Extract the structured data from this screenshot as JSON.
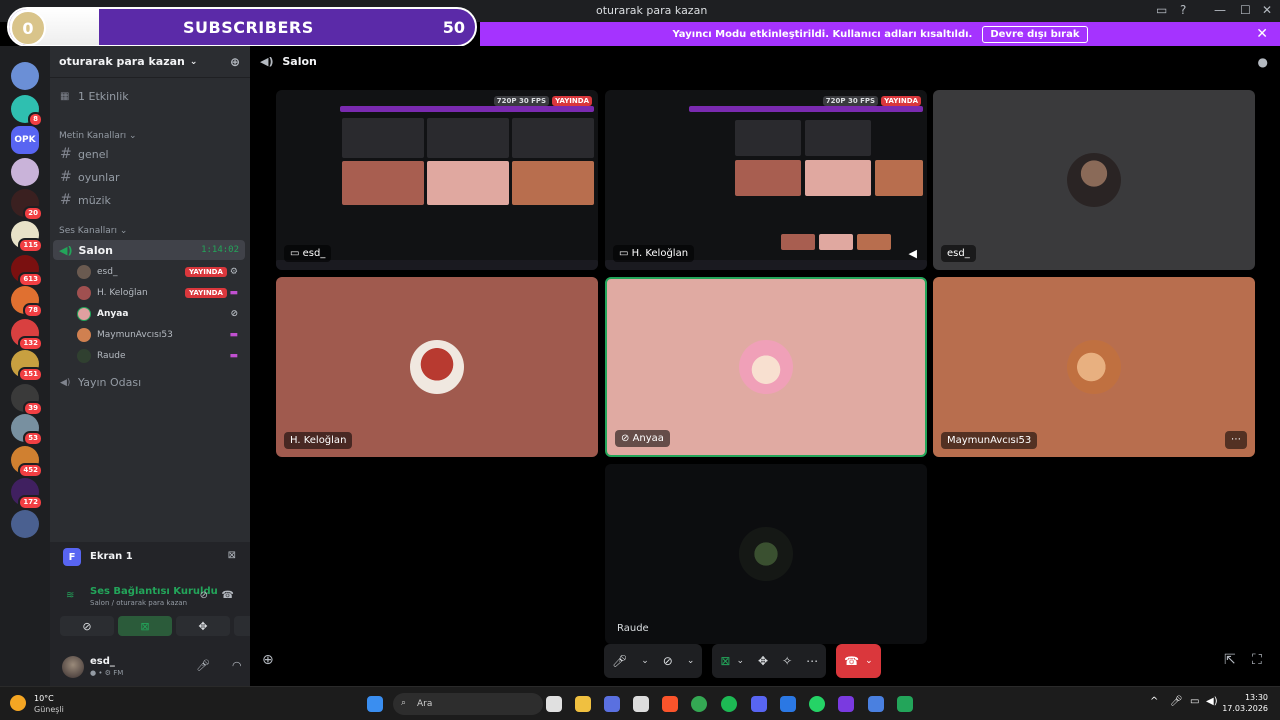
{
  "window": {
    "title": "oturarak para kazan"
  },
  "overlay": {
    "sub_count": "0",
    "label": "SUBSCRIBERS",
    "goal": "50"
  },
  "notice": {
    "text": "Yayıncı Modu etkinleştirildi. Kullanıcı adları kısaltıldı.",
    "button": "Devre dışı bırak"
  },
  "rail": {
    "servers": [
      {
        "badge": "",
        "color": "#6b8fd6"
      },
      {
        "badge": "8",
        "color": "#2fbfb0"
      },
      {
        "badge": "",
        "color": "#5865f2",
        "text": "OPK"
      },
      {
        "badge": "",
        "color": "#c9b3d9"
      },
      {
        "badge": "20",
        "color": "#3a2020"
      },
      {
        "badge": "115",
        "color": "#e8e2c8"
      },
      {
        "badge": "613",
        "color": "#7a1010"
      },
      {
        "badge": "78",
        "color": "#e07030"
      },
      {
        "badge": "132",
        "color": "#d94040"
      },
      {
        "badge": "151",
        "color": "#c8a040"
      },
      {
        "badge": "39",
        "color": "#3a3a3a"
      },
      {
        "badge": "53",
        "color": "#7890a0"
      },
      {
        "badge": "452",
        "color": "#d08030"
      },
      {
        "badge": "172",
        "color": "#402060"
      },
      {
        "badge": "",
        "color": "#4a6090"
      }
    ]
  },
  "sidebar": {
    "guild_name": "oturarak para kazan",
    "events": "1 Etkinlik",
    "text_category": "Metin Kanalları",
    "text_channels": [
      "genel",
      "oyunlar",
      "müzik"
    ],
    "voice_category": "Ses Kanalları",
    "active_voice": {
      "name": "Salon",
      "timer": "1:14:02"
    },
    "voice_users": [
      {
        "name": "esd_",
        "live": "YAYINDA",
        "color": "#6a5a50"
      },
      {
        "name": "H. Keloğlan",
        "live": "YAYINDA",
        "color": "#a05050"
      },
      {
        "name": "Anyaa",
        "live": "",
        "color": "#e0a0a0"
      },
      {
        "name": "MaymunAvcısı53",
        "live": "",
        "color": "#d08050"
      },
      {
        "name": "Raude",
        "live": "",
        "color": "#304030"
      }
    ],
    "other_voice": "Yayın Odası",
    "screen_label": "Ekran 1",
    "screen_badge": "F",
    "vc_status": "Ses Bağlantısı Kuruldu",
    "vc_sub": "Salon / oturarak para kazan",
    "user": {
      "name": "esd_",
      "status": "FM"
    }
  },
  "main": {
    "channel": "Salon",
    "streams": [
      {
        "name": "esd_",
        "quality": "720P 30 FPS",
        "live": "YAYINDA"
      },
      {
        "name": "H. Keloğlan",
        "quality": "720P 30 FPS",
        "live": "YAYINDA"
      }
    ],
    "tiles": [
      {
        "name": "esd_",
        "bg": "#3a3a3c",
        "avatar": "#5a4a40"
      },
      {
        "name": "H. Keloğlan",
        "bg": "#a05a4e",
        "avatar": "#f0e8e0"
      },
      {
        "name": "Anyaa",
        "bg": "#e0aaa2",
        "avatar": "#f0b0c0"
      },
      {
        "name": "MaymunAvcısı53",
        "bg": "#b86e4e",
        "avatar": "#d0905a"
      },
      {
        "name": "Raude",
        "bg": "#0c0d0f",
        "avatar": "#203020"
      }
    ]
  },
  "taskbar": {
    "temp": "10°C",
    "weather": "Güneşli",
    "search": "Ara",
    "time": "13:30",
    "date": "17.03.2026"
  }
}
